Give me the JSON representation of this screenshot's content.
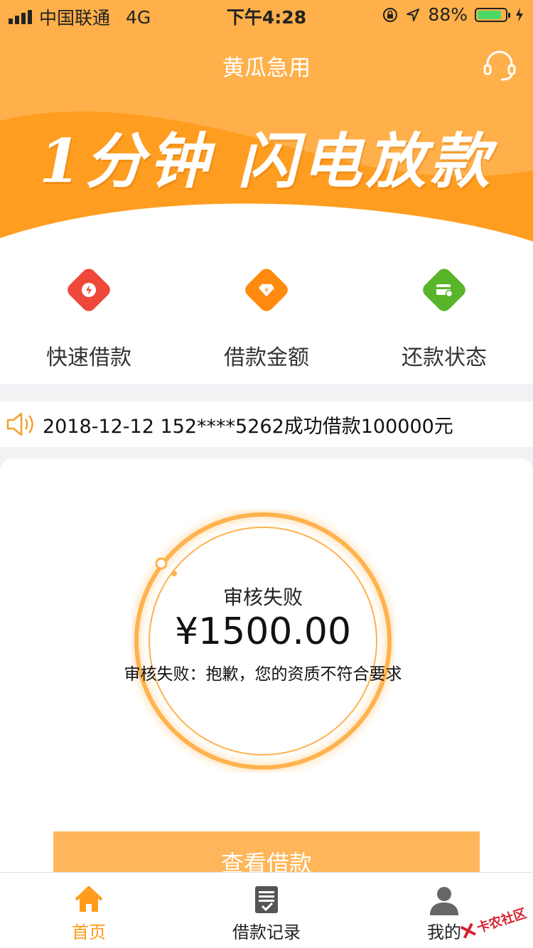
{
  "status_bar": {
    "carrier": "中国联通",
    "network": "4G",
    "time": "下午4:28",
    "battery_percent": "88%",
    "battery_level": 0.88,
    "icons": [
      "signal-icon",
      "orientation-lock-icon",
      "location-icon",
      "battery-icon",
      "charging-icon"
    ]
  },
  "header": {
    "title": "黄瓜急用",
    "slogan": "1分钟 闪电放款",
    "service_icon": "headset-icon"
  },
  "quick_menu": [
    {
      "label": "快速借款",
      "icon": "lightning-icon",
      "color": "#f0473b"
    },
    {
      "label": "借款金额",
      "icon": "diamond-yen-icon",
      "color": "#ff8a0e"
    },
    {
      "label": "还款状态",
      "icon": "card-icon",
      "color": "#58b52a"
    }
  ],
  "notice": {
    "text": "2018-12-12 152****5262成功借款100000元",
    "icon": "speaker-icon"
  },
  "loan_status": {
    "title": "审核失败",
    "amount": "¥1500.00",
    "message": "审核失败：抱歉，您的资质不符合要求",
    "button_label": "查看借款"
  },
  "tabbar": {
    "items": [
      {
        "label": "首页",
        "icon": "home-icon",
        "active": true
      },
      {
        "label": "借款记录",
        "icon": "document-icon",
        "active": false
      },
      {
        "label": "我的",
        "icon": "user-icon",
        "active": false
      }
    ]
  },
  "watermark": {
    "text": "卡农社区"
  },
  "colors": {
    "accent": "#ffb04a",
    "accent_dark": "#ff9a1a",
    "ring": "#ffb24d"
  }
}
